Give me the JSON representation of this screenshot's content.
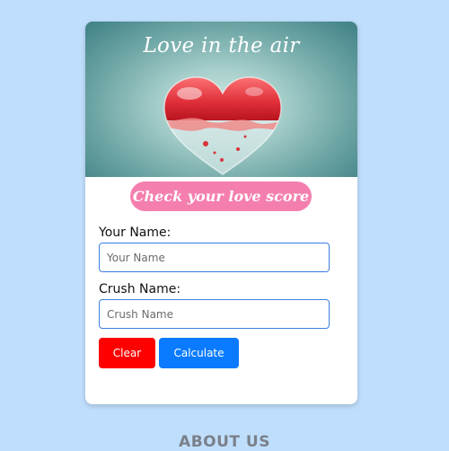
{
  "card": {
    "hero_title": "Love in the air",
    "tagline": "Check your love score"
  },
  "form": {
    "your_name_label": "Your Name:",
    "your_name_placeholder": "Your Name",
    "your_name_value": "",
    "crush_name_label": "Crush Name:",
    "crush_name_placeholder": "Crush Name",
    "crush_name_value": ""
  },
  "buttons": {
    "clear_label": "Clear",
    "calculate_label": "Calculate"
  },
  "footer": {
    "about_heading": "ABOUT US"
  },
  "icons": {
    "hero_image": "glass-heart-illustration"
  },
  "colors": {
    "page_background": "#bfdefc",
    "tagline_pill": "#f47fae",
    "clear_button": "#ff0000",
    "calculate_button": "#0a7bff",
    "input_border": "#3b7fe0"
  }
}
